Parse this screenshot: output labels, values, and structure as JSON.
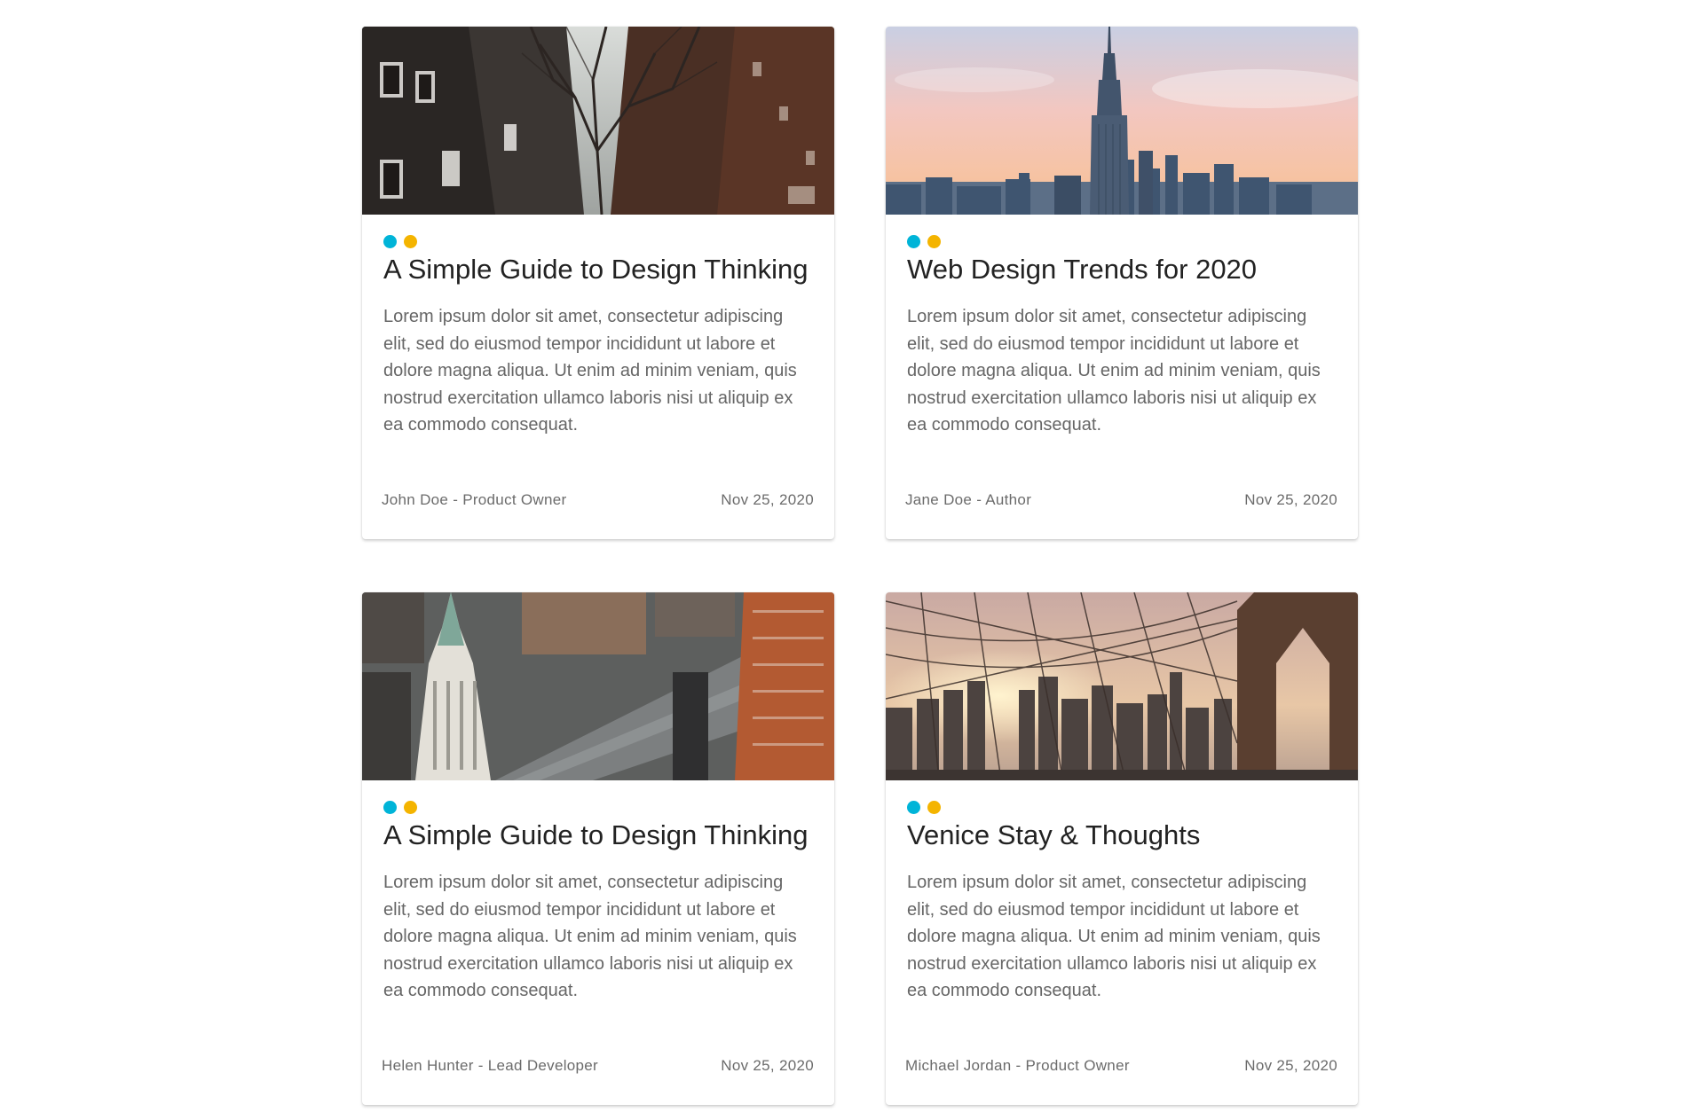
{
  "colors": {
    "dot_primary": "#00b4d8",
    "dot_secondary": "#f4b400",
    "title": "#222222",
    "text": "#666666"
  },
  "cards": [
    {
      "title": "A Simple Guide to Design Thinking",
      "excerpt": "Lorem ipsum dolor sit amet, consectetur adipiscing elit, sed do eiusmod tempor incididunt ut labore et dolore magna aliqua. Ut enim ad minim veniam, quis nostrud exercitation ullamco laboris nisi ut aliquip ex ea commodo consequat.",
      "author": "John Doe",
      "role": "Product Owner",
      "date": "Nov 25, 2020",
      "image_icon": "snowy-street-photo"
    },
    {
      "title": "Web Design Trends for 2020",
      "excerpt": "Lorem ipsum dolor sit amet, consectetur adipiscing elit, sed do eiusmod tempor incididunt ut labore et dolore magna aliqua. Ut enim ad minim veniam, quis nostrud exercitation ullamco laboris nisi ut aliquip ex ea commodo consequat.",
      "author": "Jane Doe",
      "role": "Author",
      "date": "Nov 25, 2020",
      "image_icon": "skyline-sunset-photo"
    },
    {
      "title": "A Simple Guide to Design Thinking",
      "excerpt": "Lorem ipsum dolor sit amet, consectetur adipiscing elit, sed do eiusmod tempor incididunt ut labore et dolore magna aliqua. Ut enim ad minim veniam, quis nostrud exercitation ullamco laboris nisi ut aliquip ex ea commodo consequat.",
      "author": "Helen Hunter",
      "role": "Lead Developer",
      "date": "Nov 25, 2020",
      "image_icon": "aerial-city-photo"
    },
    {
      "title": "Venice Stay & Thoughts",
      "excerpt": "Lorem ipsum dolor sit amet, consectetur adipiscing elit, sed do eiusmod tempor incididunt ut labore et dolore magna aliqua. Ut enim ad minim veniam, quis nostrud exercitation ullamco laboris nisi ut aliquip ex ea commodo consequat.",
      "author": "Michael Jordan",
      "role": "Product Owner",
      "date": "Nov 25, 2020",
      "image_icon": "bridge-cables-photo"
    }
  ]
}
